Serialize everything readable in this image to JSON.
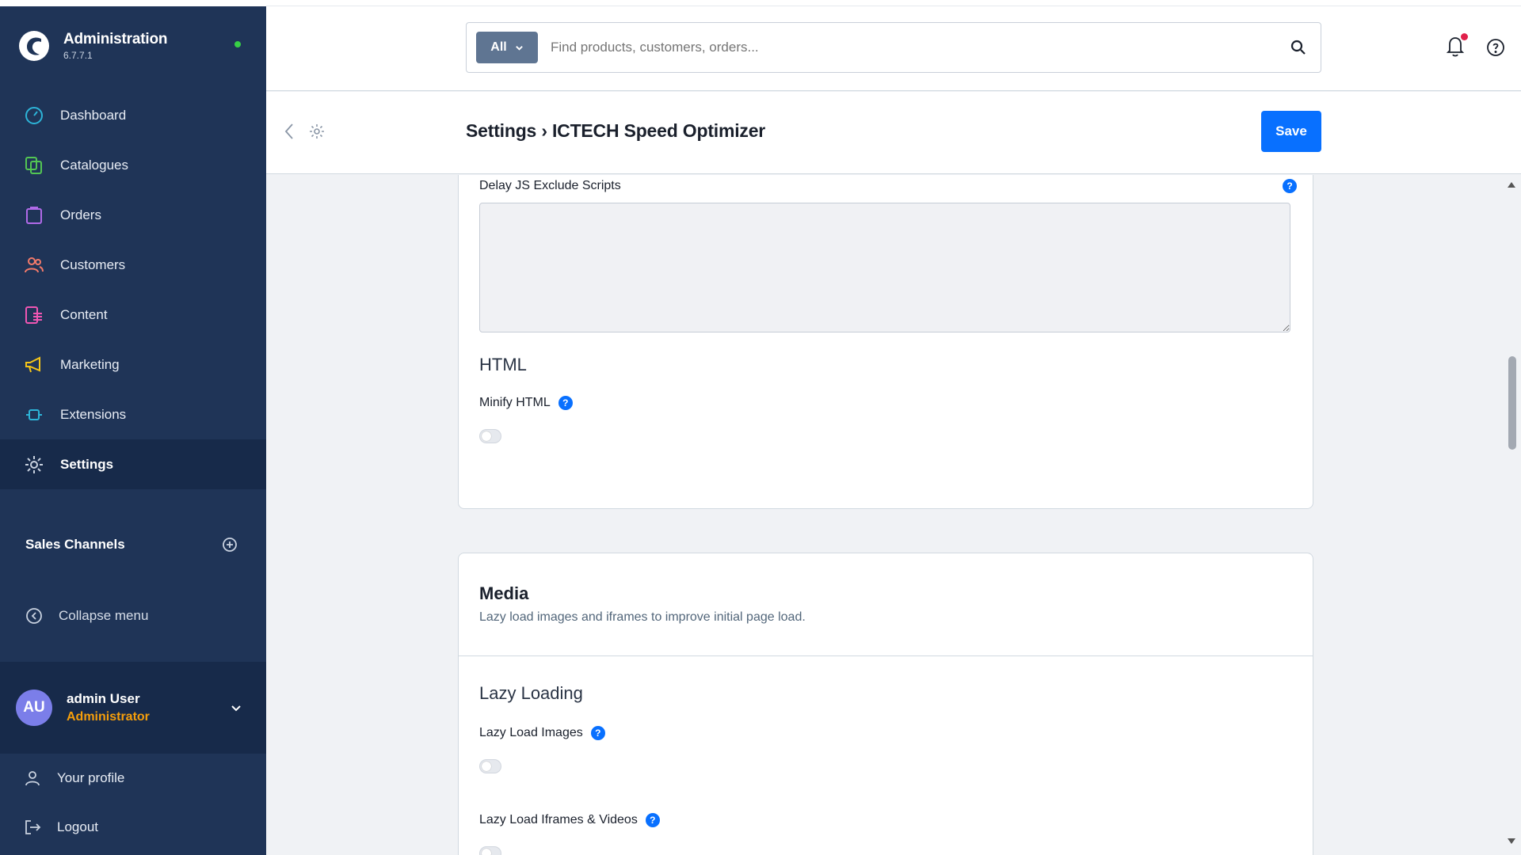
{
  "app": {
    "title": "Administration",
    "version": "6.7.7.1",
    "status_color": "#37d046"
  },
  "sidebar": {
    "items": [
      {
        "label": "Dashboard",
        "icon": "dashboard-icon",
        "color": "#2db4d8"
      },
      {
        "label": "Catalogues",
        "icon": "catalogue-icon",
        "color": "#53c653"
      },
      {
        "label": "Orders",
        "icon": "orders-icon",
        "color": "#b06ae8"
      },
      {
        "label": "Customers",
        "icon": "customers-icon",
        "color": "#f37a6a"
      },
      {
        "label": "Content",
        "icon": "content-icon",
        "color": "#f056b3"
      },
      {
        "label": "Marketing",
        "icon": "marketing-icon",
        "color": "#f5c518"
      },
      {
        "label": "Extensions",
        "icon": "extensions-icon",
        "color": "#2db4d8"
      },
      {
        "label": "Settings",
        "icon": "settings-icon",
        "color": "#c9d2e0",
        "active": true
      }
    ],
    "sales_channels_label": "Sales Channels",
    "collapse_label": "Collapse menu",
    "user": {
      "initials": "AU",
      "name": "admin User",
      "role": "Administrator"
    },
    "bottom": {
      "profile_label": "Your profile",
      "logout_label": "Logout"
    }
  },
  "search": {
    "type_label": "All",
    "placeholder": "Find products, customers, orders..."
  },
  "smartbar": {
    "title": "Settings › ICTECH Speed Optimizer",
    "save_label": "Save"
  },
  "card1": {
    "delay_js_exclude_label": "Delay JS Exclude Scripts",
    "delay_js_exclude_value": "",
    "html_heading": "HTML",
    "minify_html_label": "Minify HTML",
    "minify_html_on": false
  },
  "card2": {
    "title": "Media",
    "subtitle": "Lazy load images and iframes to improve initial page load.",
    "lazy_heading": "Lazy Loading",
    "lazy_images_label": "Lazy Load Images",
    "lazy_images_on": false,
    "lazy_iframes_label": "Lazy Load Iframes & Videos",
    "lazy_iframes_on": false
  },
  "help_marker": "?"
}
